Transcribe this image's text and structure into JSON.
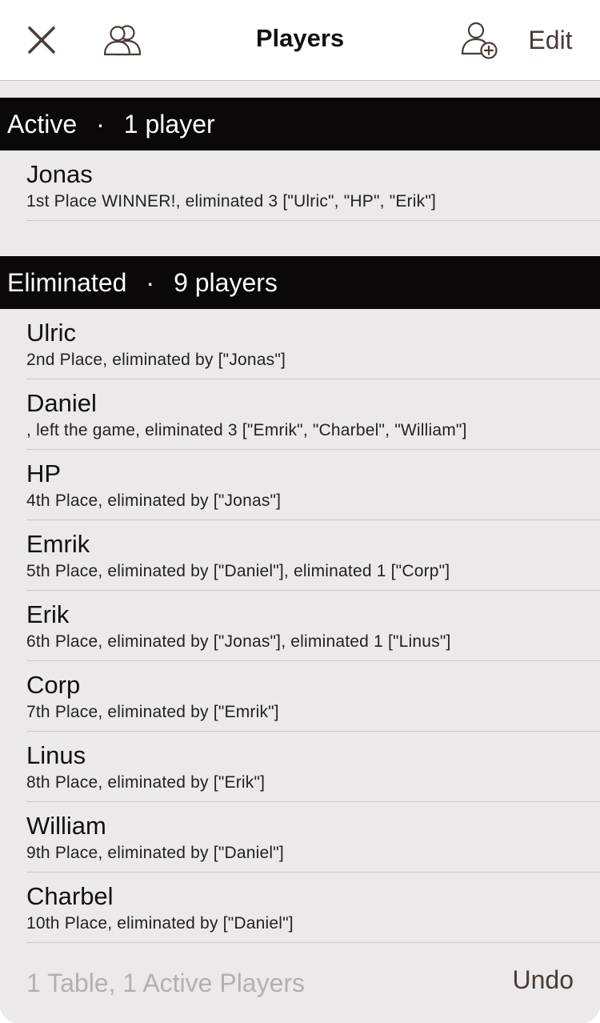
{
  "navbar": {
    "title": "Players",
    "edit_label": "Edit",
    "close_icon": "close-icon",
    "group_icon": "group-icon",
    "add_icon": "add-person-icon"
  },
  "active_section": {
    "label": "Active",
    "separator": "·",
    "count": "1 player",
    "players": [
      {
        "name": "Jonas",
        "detail": "1st Place WINNER!, eliminated 3 [\"Ulric\", \"HP\", \"Erik\"]"
      }
    ]
  },
  "eliminated_section": {
    "label": "Eliminated",
    "separator": "·",
    "count": "9 players",
    "players": [
      {
        "name": "Ulric",
        "detail": "2nd Place, eliminated by [\"Jonas\"]"
      },
      {
        "name": "Daniel",
        "detail": ", left the game, eliminated 3 [\"Emrik\", \"Charbel\", \"William\"]"
      },
      {
        "name": "HP",
        "detail": "4th Place, eliminated by [\"Jonas\"]"
      },
      {
        "name": "Emrik",
        "detail": "5th Place, eliminated by [\"Daniel\"], eliminated 1 [\"Corp\"]"
      },
      {
        "name": "Erik",
        "detail": "6th Place, eliminated by [\"Jonas\"], eliminated 1 [\"Linus\"]"
      },
      {
        "name": "Corp",
        "detail": "7th Place, eliminated by [\"Emrik\"]"
      },
      {
        "name": "Linus",
        "detail": "8th Place, eliminated by [\"Erik\"]"
      },
      {
        "name": "William",
        "detail": "9th Place, eliminated by [\"Daniel\"]"
      },
      {
        "name": "Charbel",
        "detail": "10th Place, eliminated by [\"Daniel\"]"
      }
    ]
  },
  "footer": {
    "status": "1 Table, 1 Active Players",
    "undo_label": "Undo"
  },
  "colors": {
    "accent": "#4a3b35",
    "header_bg": "#0c0708",
    "sheet_bg": "#ebe9ea",
    "muted_text": "#b2b0b1"
  }
}
